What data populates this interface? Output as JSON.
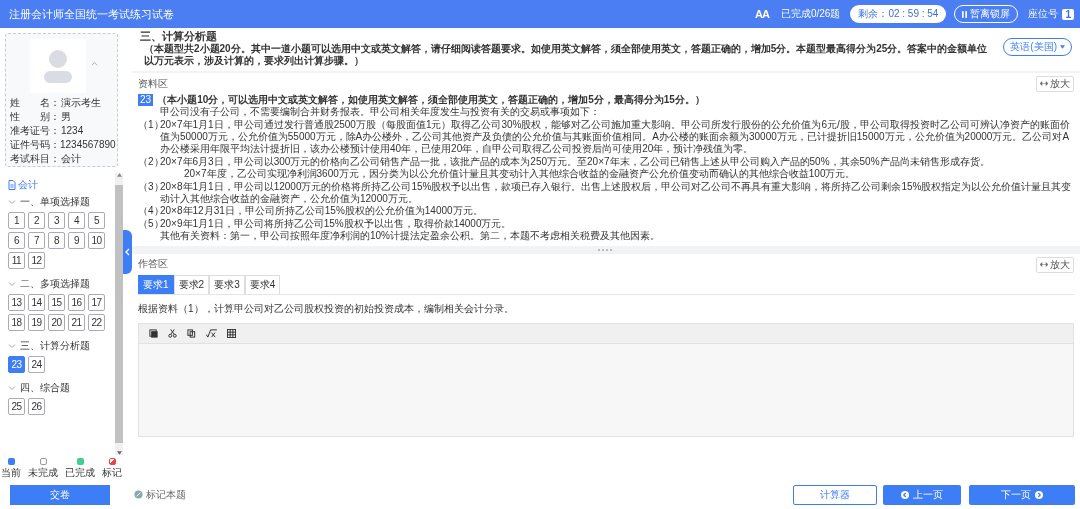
{
  "header": {
    "title": "注册会计师全国统一考试练习试卷",
    "font_button": "AA",
    "progress": "已完成0/26题",
    "timer": "剩余：02 : 59 : 54",
    "pause_button": "暂离锁屏",
    "seat_label": "座位号",
    "seat_number": "1"
  },
  "candidate": {
    "fields": [
      {
        "label": "姓　　名：",
        "value": "演示考生"
      },
      {
        "label": "性　　别：",
        "value": "男"
      },
      {
        "label": "准考证号：",
        "value": "1234"
      },
      {
        "label": "证件号码：",
        "value": "1234567890"
      },
      {
        "label": "考试科目：",
        "value": "会计"
      }
    ]
  },
  "navigator": {
    "subject": "会计",
    "sections": [
      {
        "title": "一、单项选择题",
        "expanded": true,
        "questions": [
          {
            "number": "1",
            "selected": false
          },
          {
            "number": "2",
            "selected": false
          },
          {
            "number": "3",
            "selected": false
          },
          {
            "number": "4",
            "selected": false
          },
          {
            "number": "5",
            "selected": false
          },
          {
            "number": "6",
            "selected": false
          },
          {
            "number": "7",
            "selected": false
          },
          {
            "number": "8",
            "selected": false
          },
          {
            "number": "9",
            "selected": false
          },
          {
            "number": "10",
            "selected": false
          },
          {
            "number": "11",
            "selected": false
          },
          {
            "number": "12",
            "selected": false
          }
        ]
      },
      {
        "title": "二、多项选择题",
        "expanded": true,
        "questions": [
          {
            "number": "13",
            "selected": false
          },
          {
            "number": "14",
            "selected": false
          },
          {
            "number": "15",
            "selected": false
          },
          {
            "number": "16",
            "selected": false
          },
          {
            "number": "17",
            "selected": false
          },
          {
            "number": "18",
            "selected": false
          },
          {
            "number": "19",
            "selected": false
          },
          {
            "number": "20",
            "selected": false
          },
          {
            "number": "21",
            "selected": false
          },
          {
            "number": "22",
            "selected": false
          }
        ]
      },
      {
        "title": "三、计算分析题",
        "expanded": true,
        "questions": [
          {
            "number": "23",
            "selected": true
          },
          {
            "number": "24",
            "selected": false
          }
        ]
      },
      {
        "title": "四、综合题",
        "expanded": true,
        "questions": [
          {
            "number": "25",
            "selected": false
          },
          {
            "number": "26",
            "selected": false
          }
        ]
      }
    ]
  },
  "legend": [
    {
      "label": "当前",
      "kind": "solid",
      "color": "#3d7ef6"
    },
    {
      "label": "未完成",
      "kind": "outline",
      "color": "#ffffff"
    },
    {
      "label": "已完成",
      "kind": "solid",
      "color": "#3fcf8e"
    },
    {
      "label": "标记",
      "kind": "flag",
      "color": "#e8454a"
    }
  ],
  "section": {
    "title": "三、计算分析题",
    "description": "（本题型共2小题20分。其中一道小题可以选用中文或英文解答，请仔细阅读答题要求。如使用英文解答，须全部使用英文，答题正确的，增加5分。本题型最高得分为25分。答案中的金额单位以万元表示，涉及计算的，要求列出计算步骤。）",
    "language": "英语(美国)"
  },
  "material": {
    "label": "资料区",
    "expand_button": "放大",
    "question_number": "23",
    "intro": "（本小题10分，可以选用中文或英文解答，如使用英文解答，须全部使用英文，答题正确的，增加5分，最高得分为15分。）",
    "paragraphs": [
      {
        "kind": "note",
        "text": "甲公司没有子公司，不需要编制合并财务报表。甲公司相关年度发生与投资有关的交易或事项如下："
      },
      {
        "kind": "item",
        "marker": "（1）",
        "text": "20×7年1月1日，甲公司通过发行普通股2500万股（每股面值1元）取得乙公司30%股权，能够对乙公司施加重大影响。甲公司所发行股份的公允价值为6元/股，甲公司取得投资时乙公司可辨认净资产的账面价值为50000万元，公允价值为55000万元，除A办公楼外，乙公司其他资产及负债的公允价值与其账面价值相同。A办公楼的账面余额为30000万元，已计提折旧15000万元，公允价值为20000万元。乙公司对A办公楼采用年限平均法计提折旧，该办公楼预计使用40年，已使用20年，自甲公司取得乙公司投资后尚可使用20年，预计净残值为零。"
      },
      {
        "kind": "item",
        "marker": "（2）",
        "text": "20×7年6月3日，甲公司以300万元的价格向乙公司销售产品一批，该批产品的成本为250万元。至20×7年末，乙公司已销售上述从甲公司购入产品的50%，其余50%产品尚未销售形成存货。"
      },
      {
        "kind": "subnote",
        "text": "20×7年度，乙公司实现净利润3600万元，因分类为以公允价值计量且其变动计入其他综合收益的金融资产公允价值变动而确认的其他综合收益100万元。"
      },
      {
        "kind": "item",
        "marker": "（3）",
        "text": "20×8年1月1日，甲公司以12000万元的价格将所持乙公司15%股权予以出售，款项已存入银行。出售上述股权后，甲公司对乙公司不再具有重大影响，将所持乙公司剩余15%股权指定为以公允价值计量且其变动计入其他综合收益的金融资产，公允价值为12000万元。"
      },
      {
        "kind": "item",
        "marker": "（4）",
        "text": "20×8年12月31日，甲公司所持乙公司15%股权的公允价值为14000万元。"
      },
      {
        "kind": "item",
        "marker": "（5）",
        "text": "20×9年1月1日，甲公司将所持乙公司15%股权予以出售，取得价款14000万元。"
      },
      {
        "kind": "note",
        "text": "其他有关资料：第一，甲公司按照年度净利润的10%计提法定盈余公积。第二，本题不考虑相关税费及其他因素。"
      }
    ]
  },
  "answer": {
    "label": "作答区",
    "expand_button": "放大",
    "tabs": [
      {
        "label": "要求1",
        "selected": true
      },
      {
        "label": "要求2",
        "selected": false
      },
      {
        "label": "要求3",
        "selected": false
      },
      {
        "label": "要求4",
        "selected": false
      }
    ],
    "prompt": "根据资料（1），计算甲公司对乙公司股权投资的初始投资成本，编制相关会计分录。"
  },
  "footer": {
    "submit_button": "交卷",
    "mark_button": "标记本题",
    "calculator_button": "计算器",
    "prev_button": "上一页",
    "next_button": "下一页"
  }
}
